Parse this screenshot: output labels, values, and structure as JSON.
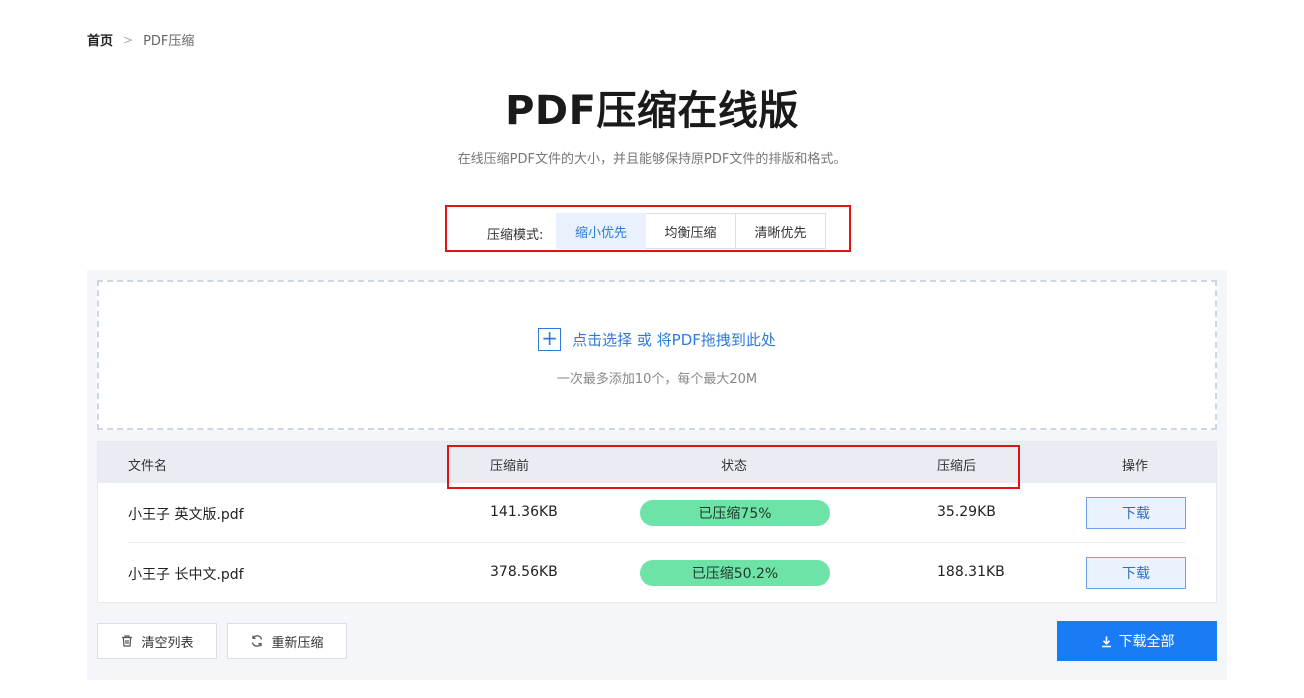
{
  "breadcrumb": {
    "home": "首页",
    "separator": ">",
    "current": "PDF压缩"
  },
  "page": {
    "title": "PDF压缩在线版",
    "subtitle": "在线压缩PDF文件的大小，并且能够保持原PDF文件的排版和格式。"
  },
  "mode": {
    "label": "压缩模式:",
    "options": [
      "缩小优先",
      "均衡压缩",
      "清晰优先"
    ],
    "selected": "缩小优先"
  },
  "upload": {
    "plus": "+",
    "prompt": "点击选择 或 将PDF拖拽到此处",
    "hint": "一次最多添加10个，每个最大20M"
  },
  "table": {
    "headers": {
      "name": "文件名",
      "before": "压缩前",
      "status": "状态",
      "after": "压缩后",
      "action": "操作"
    },
    "rows": [
      {
        "name": "小王子 英文版.pdf",
        "before": "141.36KB",
        "status": "已压缩75%",
        "after": "35.29KB",
        "action": "下载"
      },
      {
        "name": "小王子 长中文.pdf",
        "before": "378.56KB",
        "status": "已压缩50.2%",
        "after": "188.31KB",
        "action": "下载"
      }
    ]
  },
  "footer": {
    "clear": "清空列表",
    "recompress": "重新压缩",
    "download_all": "下载全部"
  },
  "colors": {
    "accent": "#1a7cf5",
    "link": "#2f7bd9",
    "status_fill": "#6ee3a7",
    "highlight_frame": "#e01414"
  },
  "icons": [
    "plus-icon",
    "trash-icon",
    "refresh-icon",
    "download-icon",
    "chevron-right-icon"
  ]
}
